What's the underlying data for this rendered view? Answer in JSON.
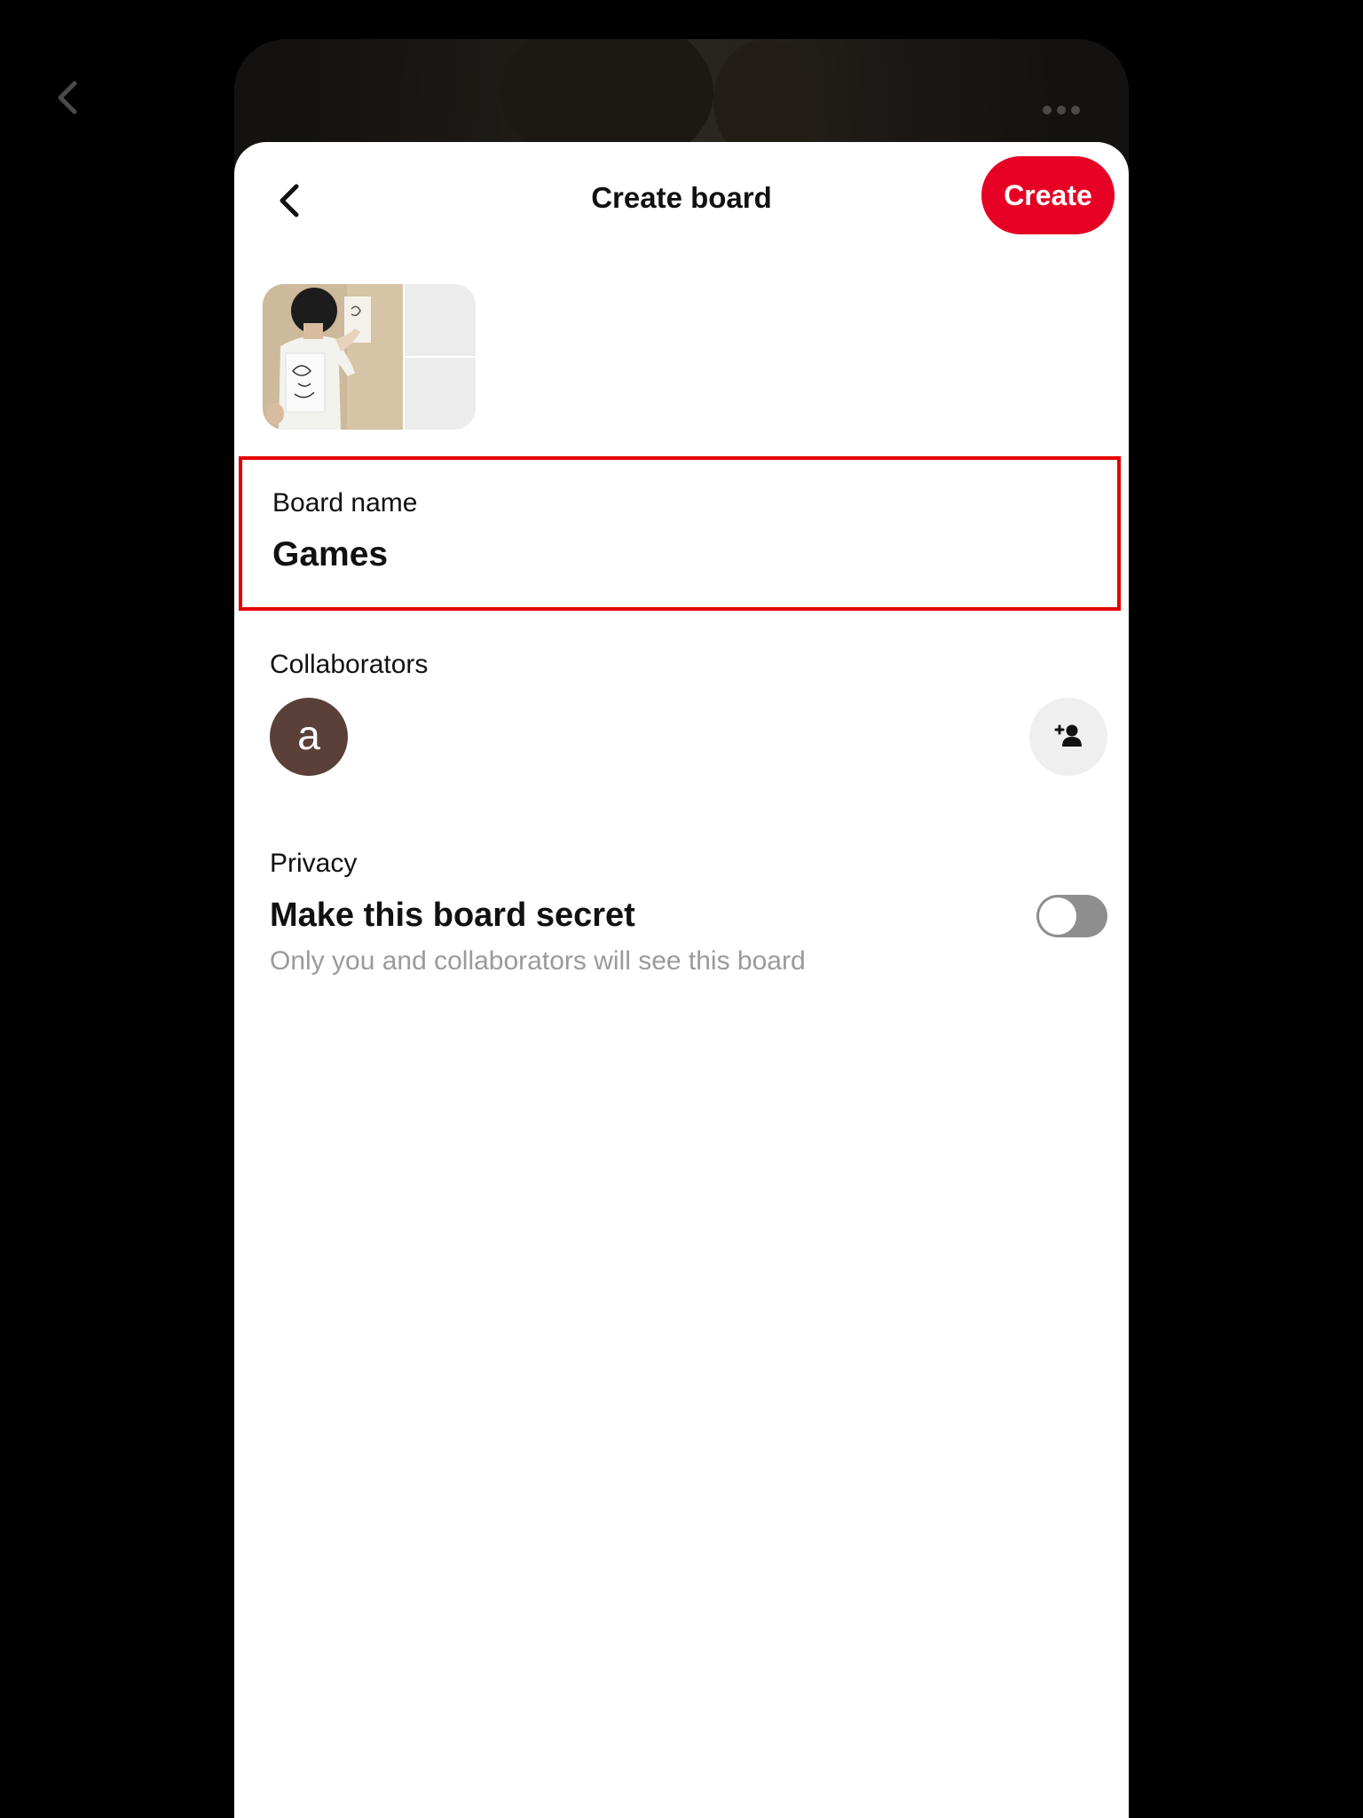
{
  "header": {
    "title": "Create board",
    "create_label": "Create"
  },
  "board_name": {
    "label": "Board name",
    "value": "Games"
  },
  "collaborators": {
    "label": "Collaborators",
    "avatar_initial": "a",
    "avatar_color": "#5a4038",
    "add_icon": "add-person-icon"
  },
  "privacy": {
    "label": "Privacy",
    "title": "Make this board secret",
    "subtitle": "Only you and collaborators will see this board",
    "toggle_on": false
  },
  "colors": {
    "accent": "#e60023",
    "highlight_border": "#e30000"
  },
  "icons": {
    "outer_back": "chevron-left-icon",
    "back": "chevron-left-icon",
    "more": "more-horizontal-icon"
  }
}
